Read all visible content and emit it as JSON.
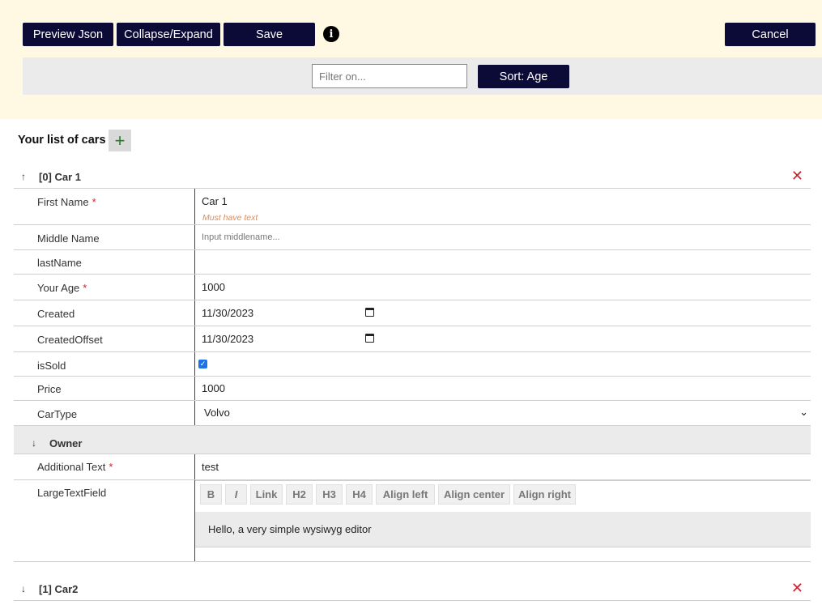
{
  "toolbar": {
    "preview_label": "Preview Json",
    "collapse_label": "Collapse/Expand",
    "save_label": "Save",
    "info_glyph": "i",
    "cancel_label": "Cancel"
  },
  "filter": {
    "placeholder": "Filter on...",
    "sort_label": "Sort: Age"
  },
  "list": {
    "title": "Your list of cars",
    "add_glyph": "+",
    "remove_glyph": "✕",
    "items": [
      {
        "arrow": "↑",
        "title": "[0] Car 1"
      },
      {
        "arrow": "↓",
        "title": "[1] Car2"
      }
    ]
  },
  "fields": {
    "first_name": {
      "label": "First Name",
      "value": "Car 1",
      "hint": "Must have text",
      "required": "*"
    },
    "middle_name": {
      "label": "Middle Name",
      "placeholder": "Input middlename..."
    },
    "last_name": {
      "label": "lastName",
      "value": ""
    },
    "age": {
      "label": "Your Age",
      "value": "1000",
      "required": "*"
    },
    "created": {
      "label": "Created",
      "value": "11/30/2023"
    },
    "created_offset": {
      "label": "CreatedOffset",
      "value": "11/30/2023"
    },
    "is_sold": {
      "label": "isSold",
      "checked": "true"
    },
    "price": {
      "label": "Price",
      "value": "1000"
    },
    "car_type": {
      "label": "CarType",
      "value": "Volvo"
    }
  },
  "owner": {
    "arrow": "↓",
    "title": "Owner",
    "additional_text": {
      "label": "Additional Text",
      "value": "test",
      "required": "*"
    },
    "large_text": {
      "label": "LargeTextField",
      "buttons": [
        "B",
        "I",
        "Link",
        "H2",
        "H3",
        "H4",
        "Align left",
        "Align center",
        "Align right"
      ],
      "content": "Hello, a very simple wysiwyg editor"
    }
  },
  "colors": {
    "button_bg": "#0c0a36",
    "toolbar_bg": "#fff8e2",
    "required": "#d01f2f",
    "hint": "#e38a55",
    "add": "#2b7a2b"
  }
}
